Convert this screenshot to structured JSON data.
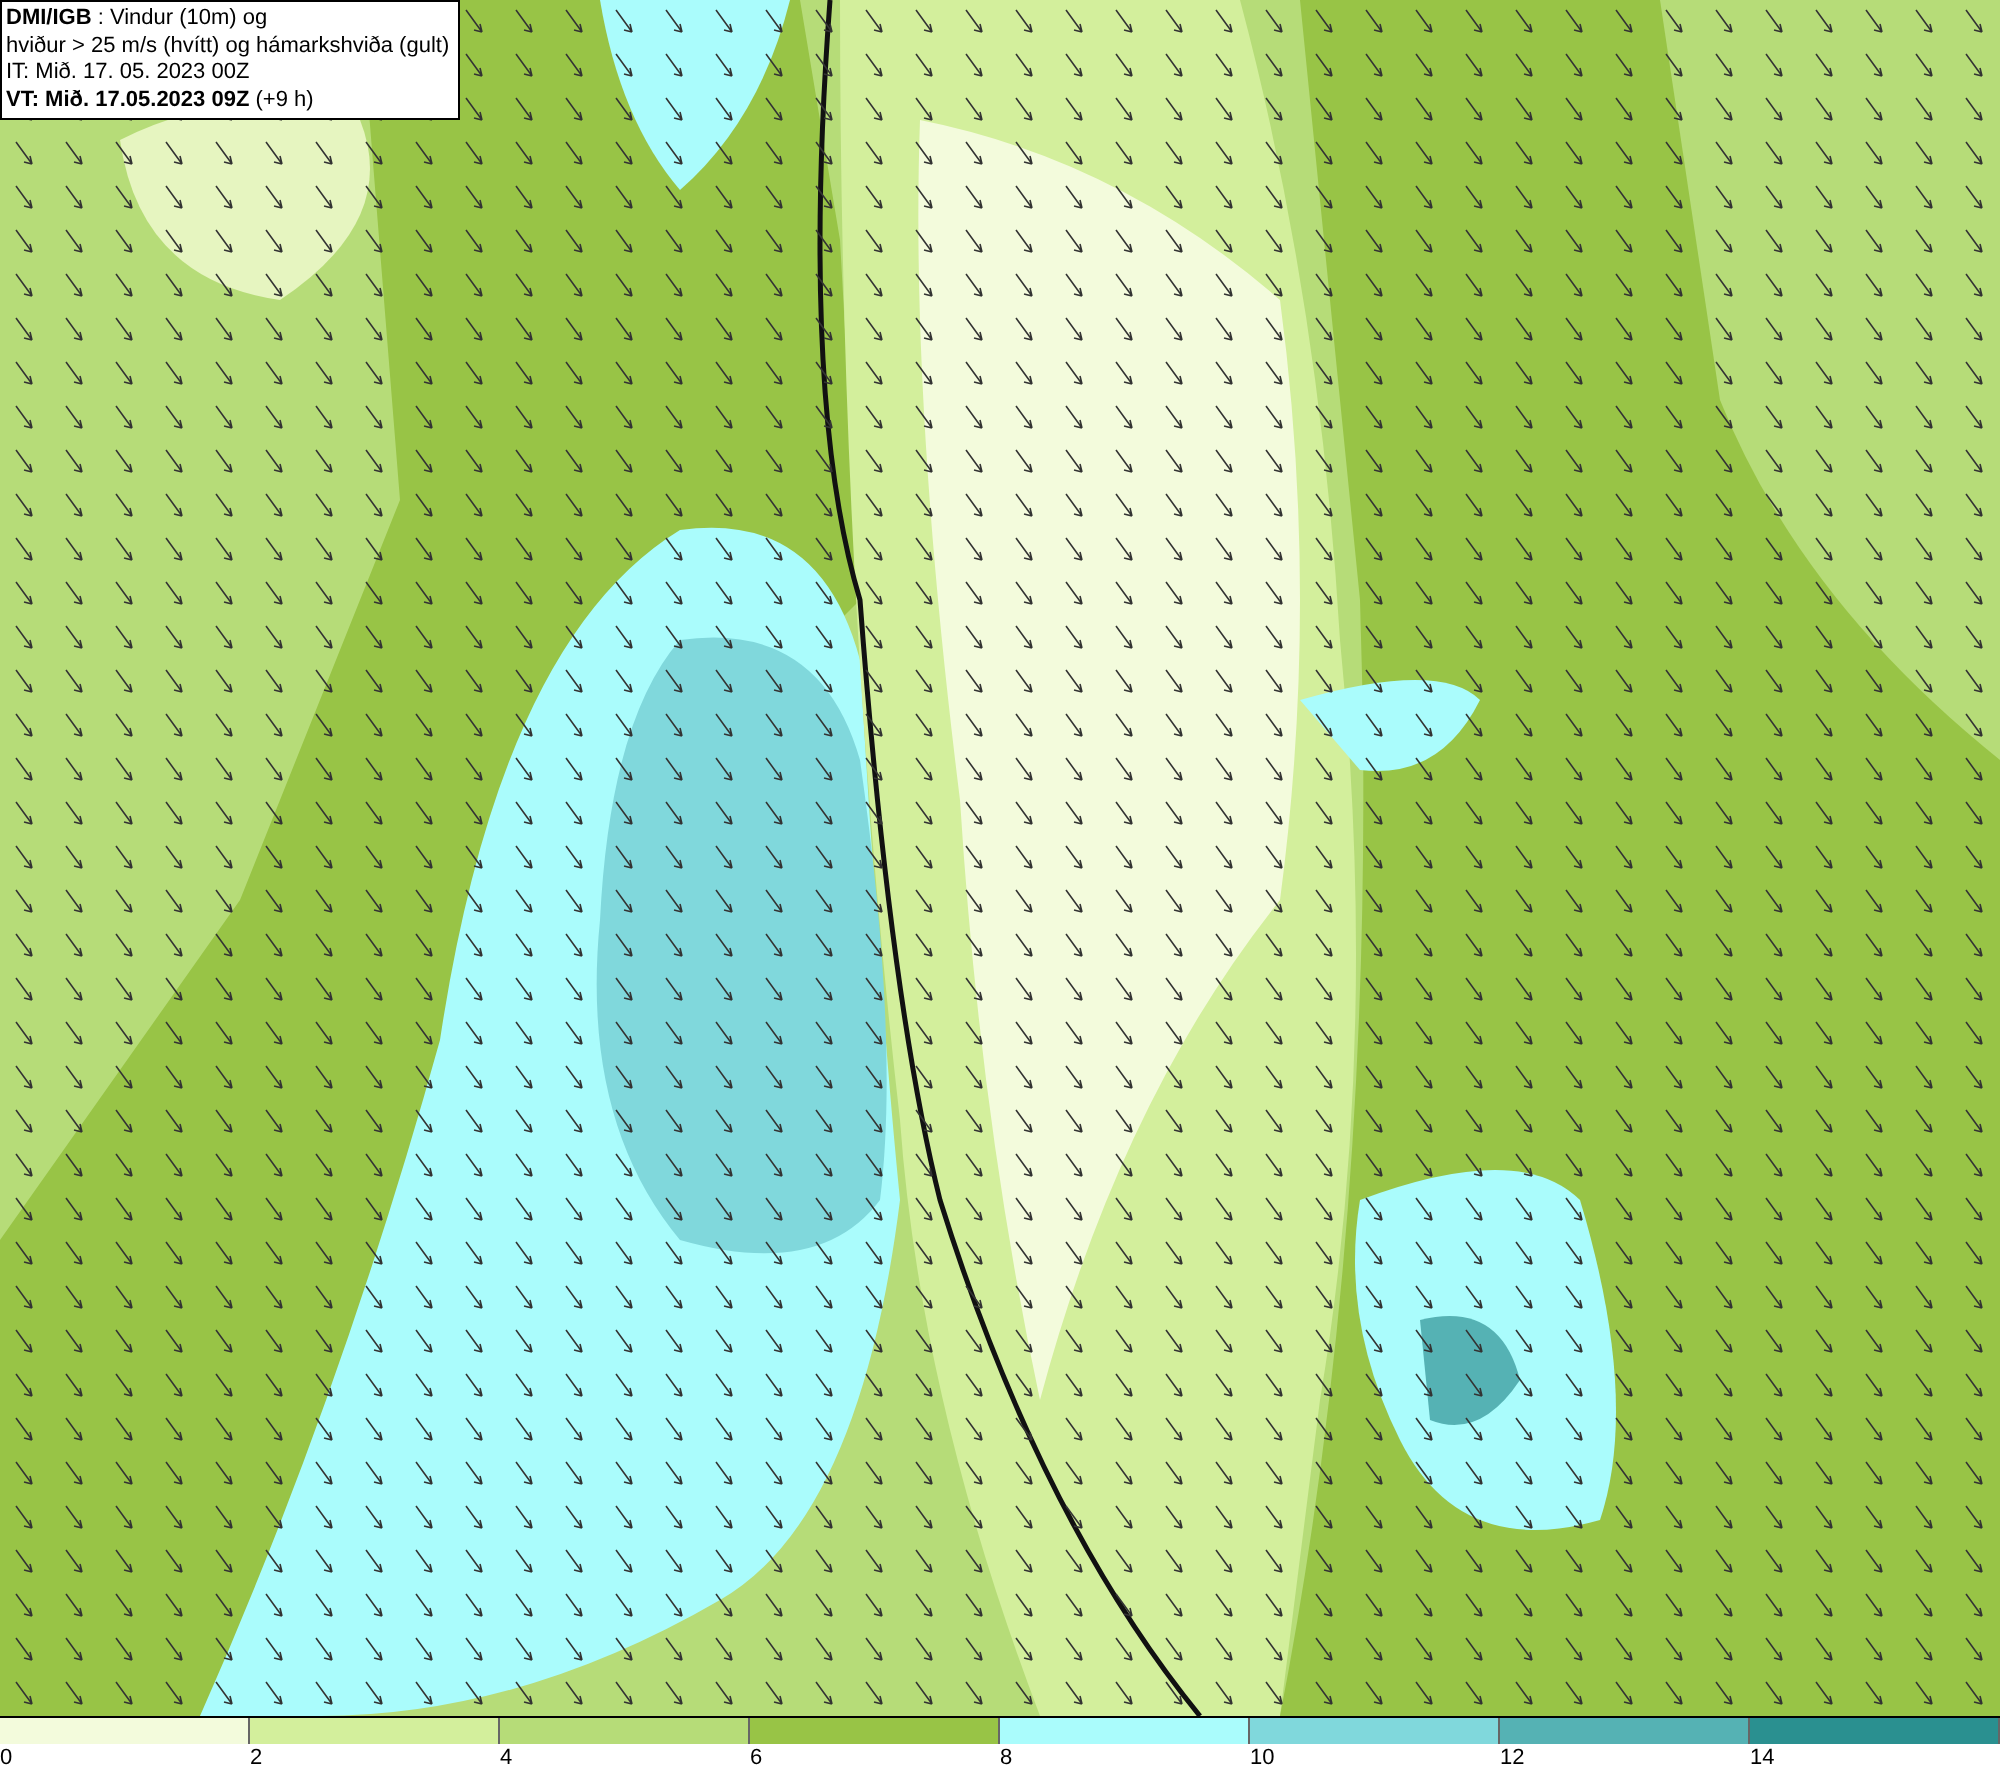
{
  "title_box": {
    "lines": [
      "**DMI/IGB** : Vindur (10m) og",
      "hviður > 25 m/s (hvítt) og hámarkshviða (gult)",
      "IT: Mið. 17. 05. 2023 00Z",
      "**VT: Mið. 17.05.2023 09Z** (+9 h)"
    ]
  },
  "legend": [
    {
      "label": "0",
      "color": "#f3fbdc"
    },
    {
      "label": "2",
      "color": "#d3ef9c"
    },
    {
      "label": "4",
      "color": "#b6dc78"
    },
    {
      "label": "6",
      "color": "#98c446"
    },
    {
      "label": "8",
      "color": "#aafcfc"
    },
    {
      "label": "10",
      "color": "#80d8dc"
    },
    {
      "label": "12",
      "color": "#55b2b4"
    },
    {
      "label": "14",
      "color": "#2a9090"
    }
  ]
}
